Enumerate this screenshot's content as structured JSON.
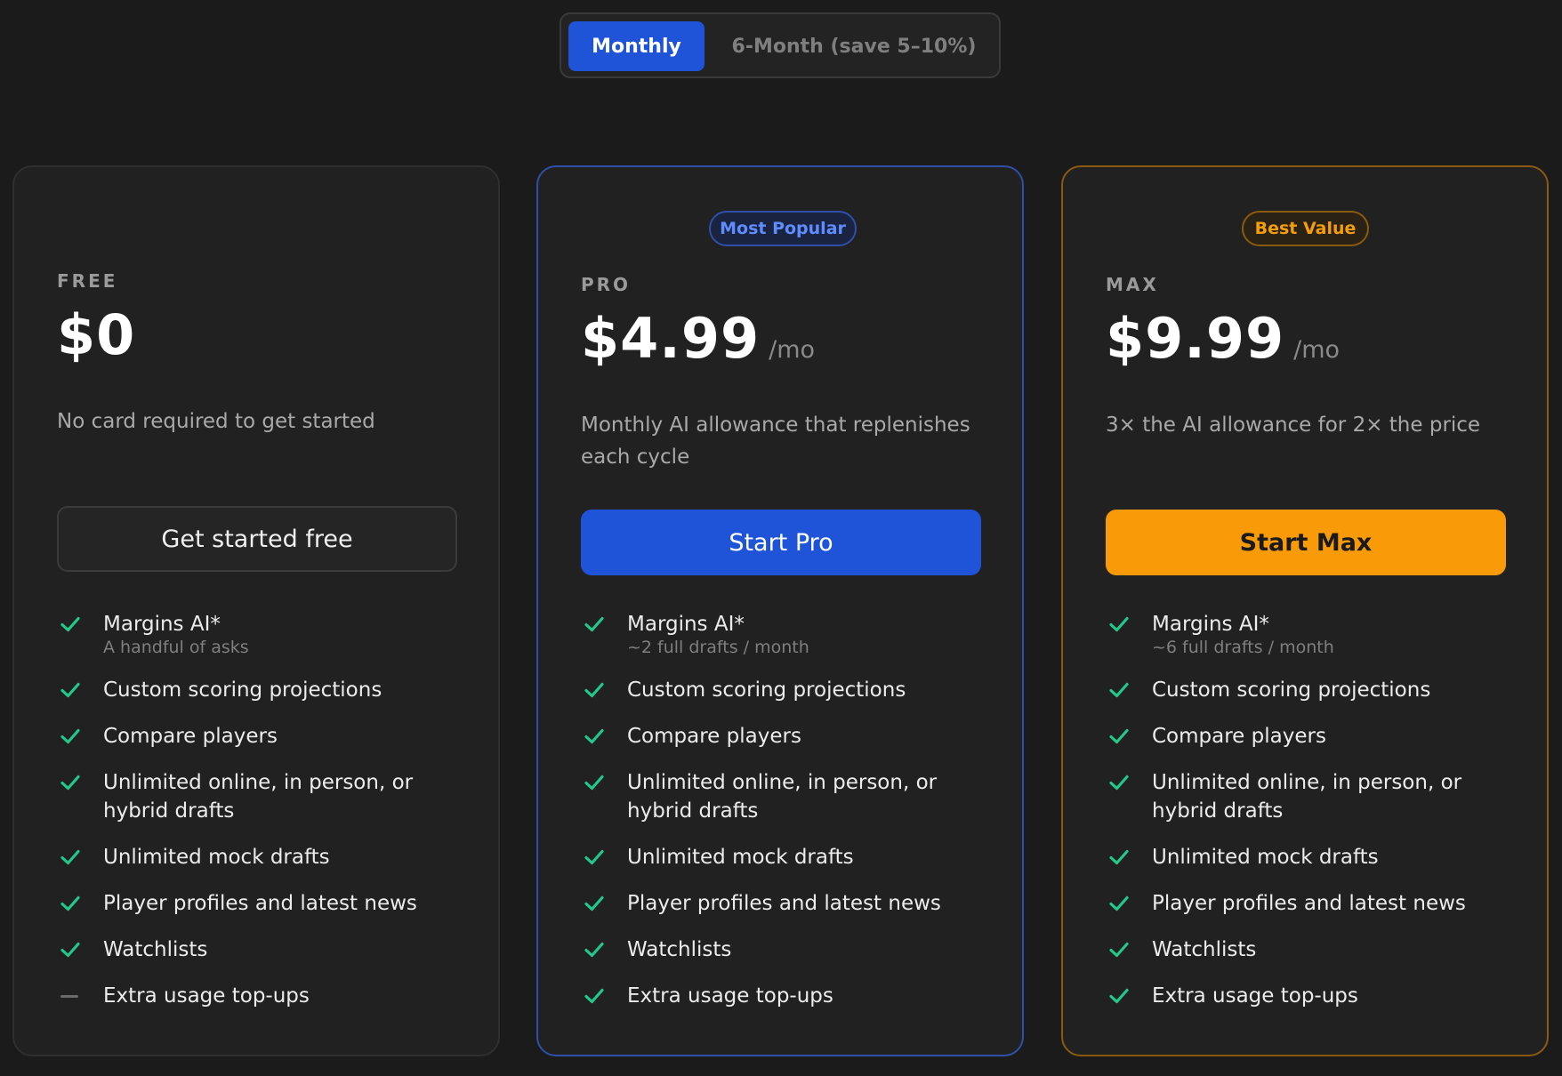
{
  "toggle": {
    "monthly": "Monthly",
    "six_month": "6-Month (save 5–10%)"
  },
  "colors": {
    "background": "#1b1b1b",
    "pro_accent": "#1f54d8",
    "max_accent": "#f99b08",
    "check": "#22c98a"
  },
  "plans": [
    {
      "tier": "FREE",
      "price": "$0",
      "period": "",
      "badge": "",
      "description": "No card required to get started",
      "cta": "Get started free",
      "features": [
        {
          "label": "Margins AI*",
          "sub": "A handful of asks",
          "icon": "check-icon"
        },
        {
          "label": "Custom scoring projections",
          "icon": "check-icon"
        },
        {
          "label": "Compare players",
          "icon": "check-icon"
        },
        {
          "label": "Unlimited online, in person, or hybrid drafts",
          "icon": "check-icon"
        },
        {
          "label": "Unlimited mock drafts",
          "icon": "check-icon"
        },
        {
          "label": "Player profiles and latest news",
          "icon": "check-icon"
        },
        {
          "label": "Watchlists",
          "icon": "check-icon"
        },
        {
          "label": "Extra usage top-ups",
          "icon": "dash-icon"
        }
      ]
    },
    {
      "tier": "PRO",
      "price": "$4.99",
      "period": "/mo",
      "badge": "Most Popular",
      "description": "Monthly AI allowance that replenishes each cycle",
      "cta": "Start Pro",
      "features": [
        {
          "label": "Margins AI*",
          "sub": "~2 full drafts / month",
          "icon": "check-icon"
        },
        {
          "label": "Custom scoring projections",
          "icon": "check-icon"
        },
        {
          "label": "Compare players",
          "icon": "check-icon"
        },
        {
          "label": "Unlimited online, in person, or hybrid drafts",
          "icon": "check-icon"
        },
        {
          "label": "Unlimited mock drafts",
          "icon": "check-icon"
        },
        {
          "label": "Player profiles and latest news",
          "icon": "check-icon"
        },
        {
          "label": "Watchlists",
          "icon": "check-icon"
        },
        {
          "label": "Extra usage top-ups",
          "icon": "check-icon"
        }
      ]
    },
    {
      "tier": "MAX",
      "price": "$9.99",
      "period": "/mo",
      "badge": "Best Value",
      "description": "3× the AI allowance for 2× the price",
      "cta": "Start Max",
      "features": [
        {
          "label": "Margins AI*",
          "sub": "~6 full drafts / month",
          "icon": "check-icon"
        },
        {
          "label": "Custom scoring projections",
          "icon": "check-icon"
        },
        {
          "label": "Compare players",
          "icon": "check-icon"
        },
        {
          "label": "Unlimited online, in person, or hybrid drafts",
          "icon": "check-icon"
        },
        {
          "label": "Unlimited mock drafts",
          "icon": "check-icon"
        },
        {
          "label": "Player profiles and latest news",
          "icon": "check-icon"
        },
        {
          "label": "Watchlists",
          "icon": "check-icon"
        },
        {
          "label": "Extra usage top-ups",
          "icon": "check-icon"
        }
      ]
    }
  ]
}
